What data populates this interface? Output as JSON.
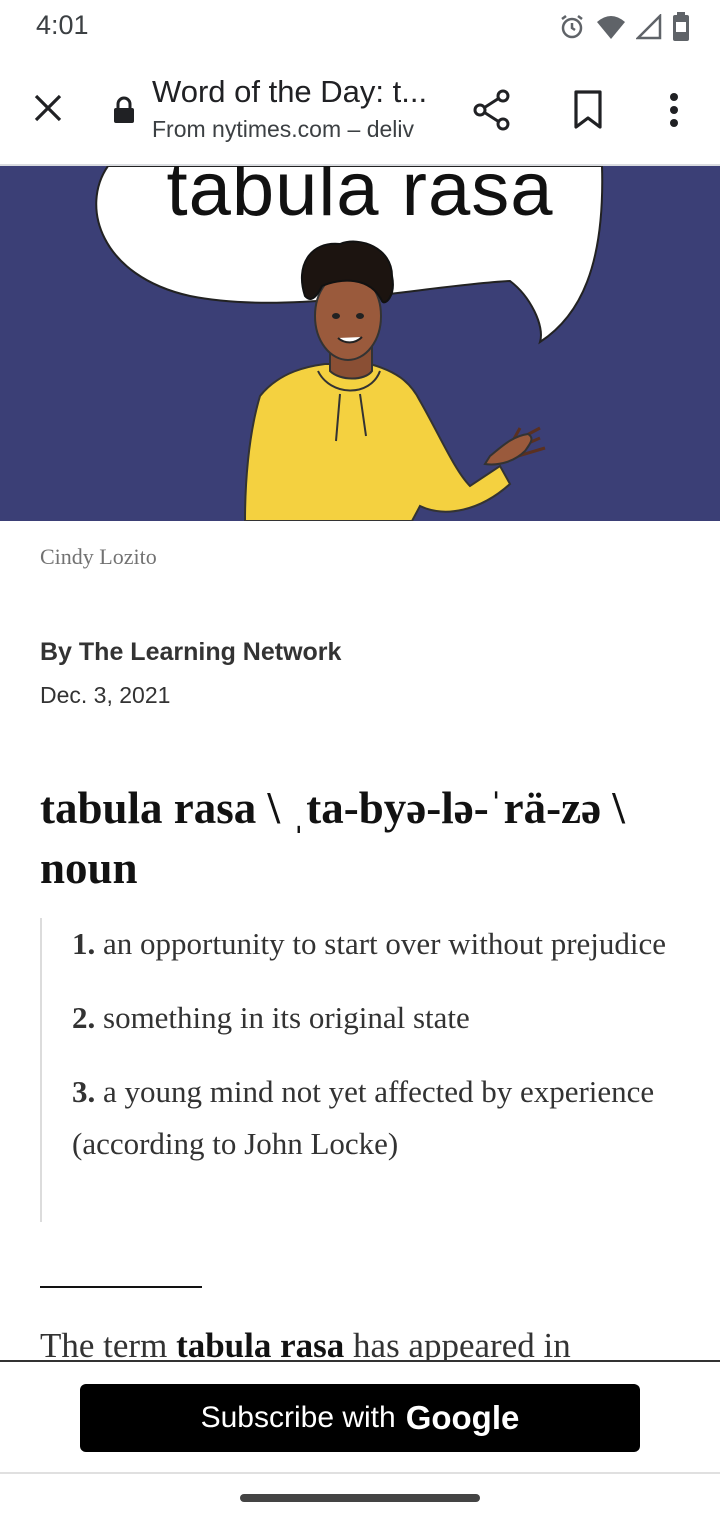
{
  "status_bar": {
    "time": "4:01",
    "icons": [
      "alarm-icon",
      "wifi-icon",
      "cellular-icon",
      "battery-icon"
    ]
  },
  "toolbar": {
    "close_icon": "close-icon",
    "lock_icon": "lock-icon",
    "title": "Word of the Day: t...",
    "subtitle": "From nytimes.com – deliv",
    "share_icon": "share-icon",
    "bookmark_icon": "bookmark-icon",
    "menu_icon": "more-vert-icon"
  },
  "hero": {
    "word": "tabula rasa",
    "colors": {
      "background": "#3b3f76",
      "hoodie": "#f4d140"
    }
  },
  "article": {
    "caption": "Cindy Lozito",
    "byline": "By The Learning Network",
    "date": "Dec. 3, 2021",
    "headword": "tabula rasa \\ ˌta-byə-lə-ˈrä-zə \\ noun",
    "definitions": [
      {
        "num": "1.",
        "text": "an opportunity to start over without prejudice"
      },
      {
        "num": "2.",
        "text": "something in its original state"
      },
      {
        "num": "3.",
        "text": "a young mind not yet affected by experience (according to John Locke)"
      }
    ],
    "body_prefix": "The term ",
    "body_bold": "tabula rasa",
    "body_suffix": " has appeared in"
  },
  "subscribe": {
    "label": "Subscribe with",
    "brand": "Google"
  }
}
